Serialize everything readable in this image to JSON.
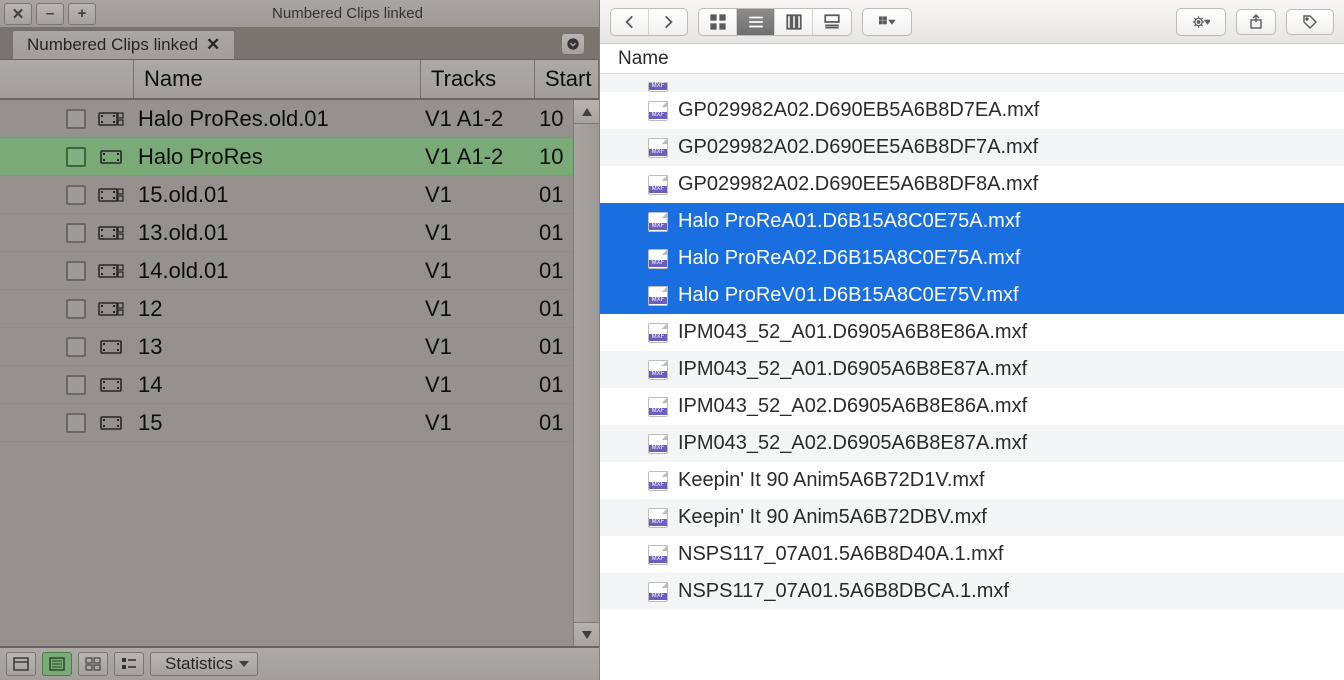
{
  "avid": {
    "window_title": "Numbered Clips linked",
    "tab_label": "Numbered Clips linked",
    "columns": {
      "name": "Name",
      "tracks": "Tracks",
      "start": "Start"
    },
    "stats_label": "Statistics",
    "rows": [
      {
        "name": "Halo ProRes.old.01",
        "tracks": "V1 A1-2",
        "start": "10",
        "type": "linked",
        "selected": false
      },
      {
        "name": "Halo ProRes",
        "tracks": "V1 A1-2",
        "start": "10",
        "type": "master",
        "selected": true
      },
      {
        "name": "15.old.01",
        "tracks": "V1",
        "start": "01",
        "type": "linked",
        "selected": false
      },
      {
        "name": "13.old.01",
        "tracks": "V1",
        "start": "01",
        "type": "linked",
        "selected": false
      },
      {
        "name": "14.old.01",
        "tracks": "V1",
        "start": "01",
        "type": "linked",
        "selected": false
      },
      {
        "name": "12",
        "tracks": "V1",
        "start": "01",
        "type": "linked",
        "selected": false
      },
      {
        "name": "13",
        "tracks": "V1",
        "start": "01",
        "type": "master",
        "selected": false
      },
      {
        "name": "14",
        "tracks": "V1",
        "start": "01",
        "type": "master",
        "selected": false
      },
      {
        "name": "15",
        "tracks": "V1",
        "start": "01",
        "type": "master",
        "selected": false
      }
    ]
  },
  "finder": {
    "column_label": "Name",
    "rows": [
      {
        "name": "GP029982A02.D690EB5A6B8D7EA.mxf",
        "selected": false,
        "alt": false
      },
      {
        "name": "GP029982A02.D690EE5A6B8DF7A.mxf",
        "selected": false,
        "alt": true
      },
      {
        "name": "GP029982A02.D690EE5A6B8DF8A.mxf",
        "selected": false,
        "alt": false
      },
      {
        "name": "Halo ProReA01.D6B15A8C0E75A.mxf",
        "selected": true,
        "alt": true
      },
      {
        "name": "Halo ProReA02.D6B15A8C0E75A.mxf",
        "selected": true,
        "alt": false
      },
      {
        "name": "Halo ProReV01.D6B15A8C0E75V.mxf",
        "selected": true,
        "alt": true
      },
      {
        "name": "IPM043_52_A01.D6905A6B8E86A.mxf",
        "selected": false,
        "alt": false
      },
      {
        "name": "IPM043_52_A01.D6905A6B8E87A.mxf",
        "selected": false,
        "alt": true
      },
      {
        "name": "IPM043_52_A02.D6905A6B8E86A.mxf",
        "selected": false,
        "alt": false
      },
      {
        "name": "IPM043_52_A02.D6905A6B8E87A.mxf",
        "selected": false,
        "alt": true
      },
      {
        "name": "Keepin' It 90 Anim5A6B72D1V.mxf",
        "selected": false,
        "alt": false
      },
      {
        "name": "Keepin' It 90 Anim5A6B72DBV.mxf",
        "selected": false,
        "alt": true
      },
      {
        "name": "NSPS117_07A01.5A6B8D40A.1.mxf",
        "selected": false,
        "alt": false
      },
      {
        "name": "NSPS117_07A01.5A6B8DBCA.1.mxf",
        "selected": false,
        "alt": true
      }
    ]
  }
}
